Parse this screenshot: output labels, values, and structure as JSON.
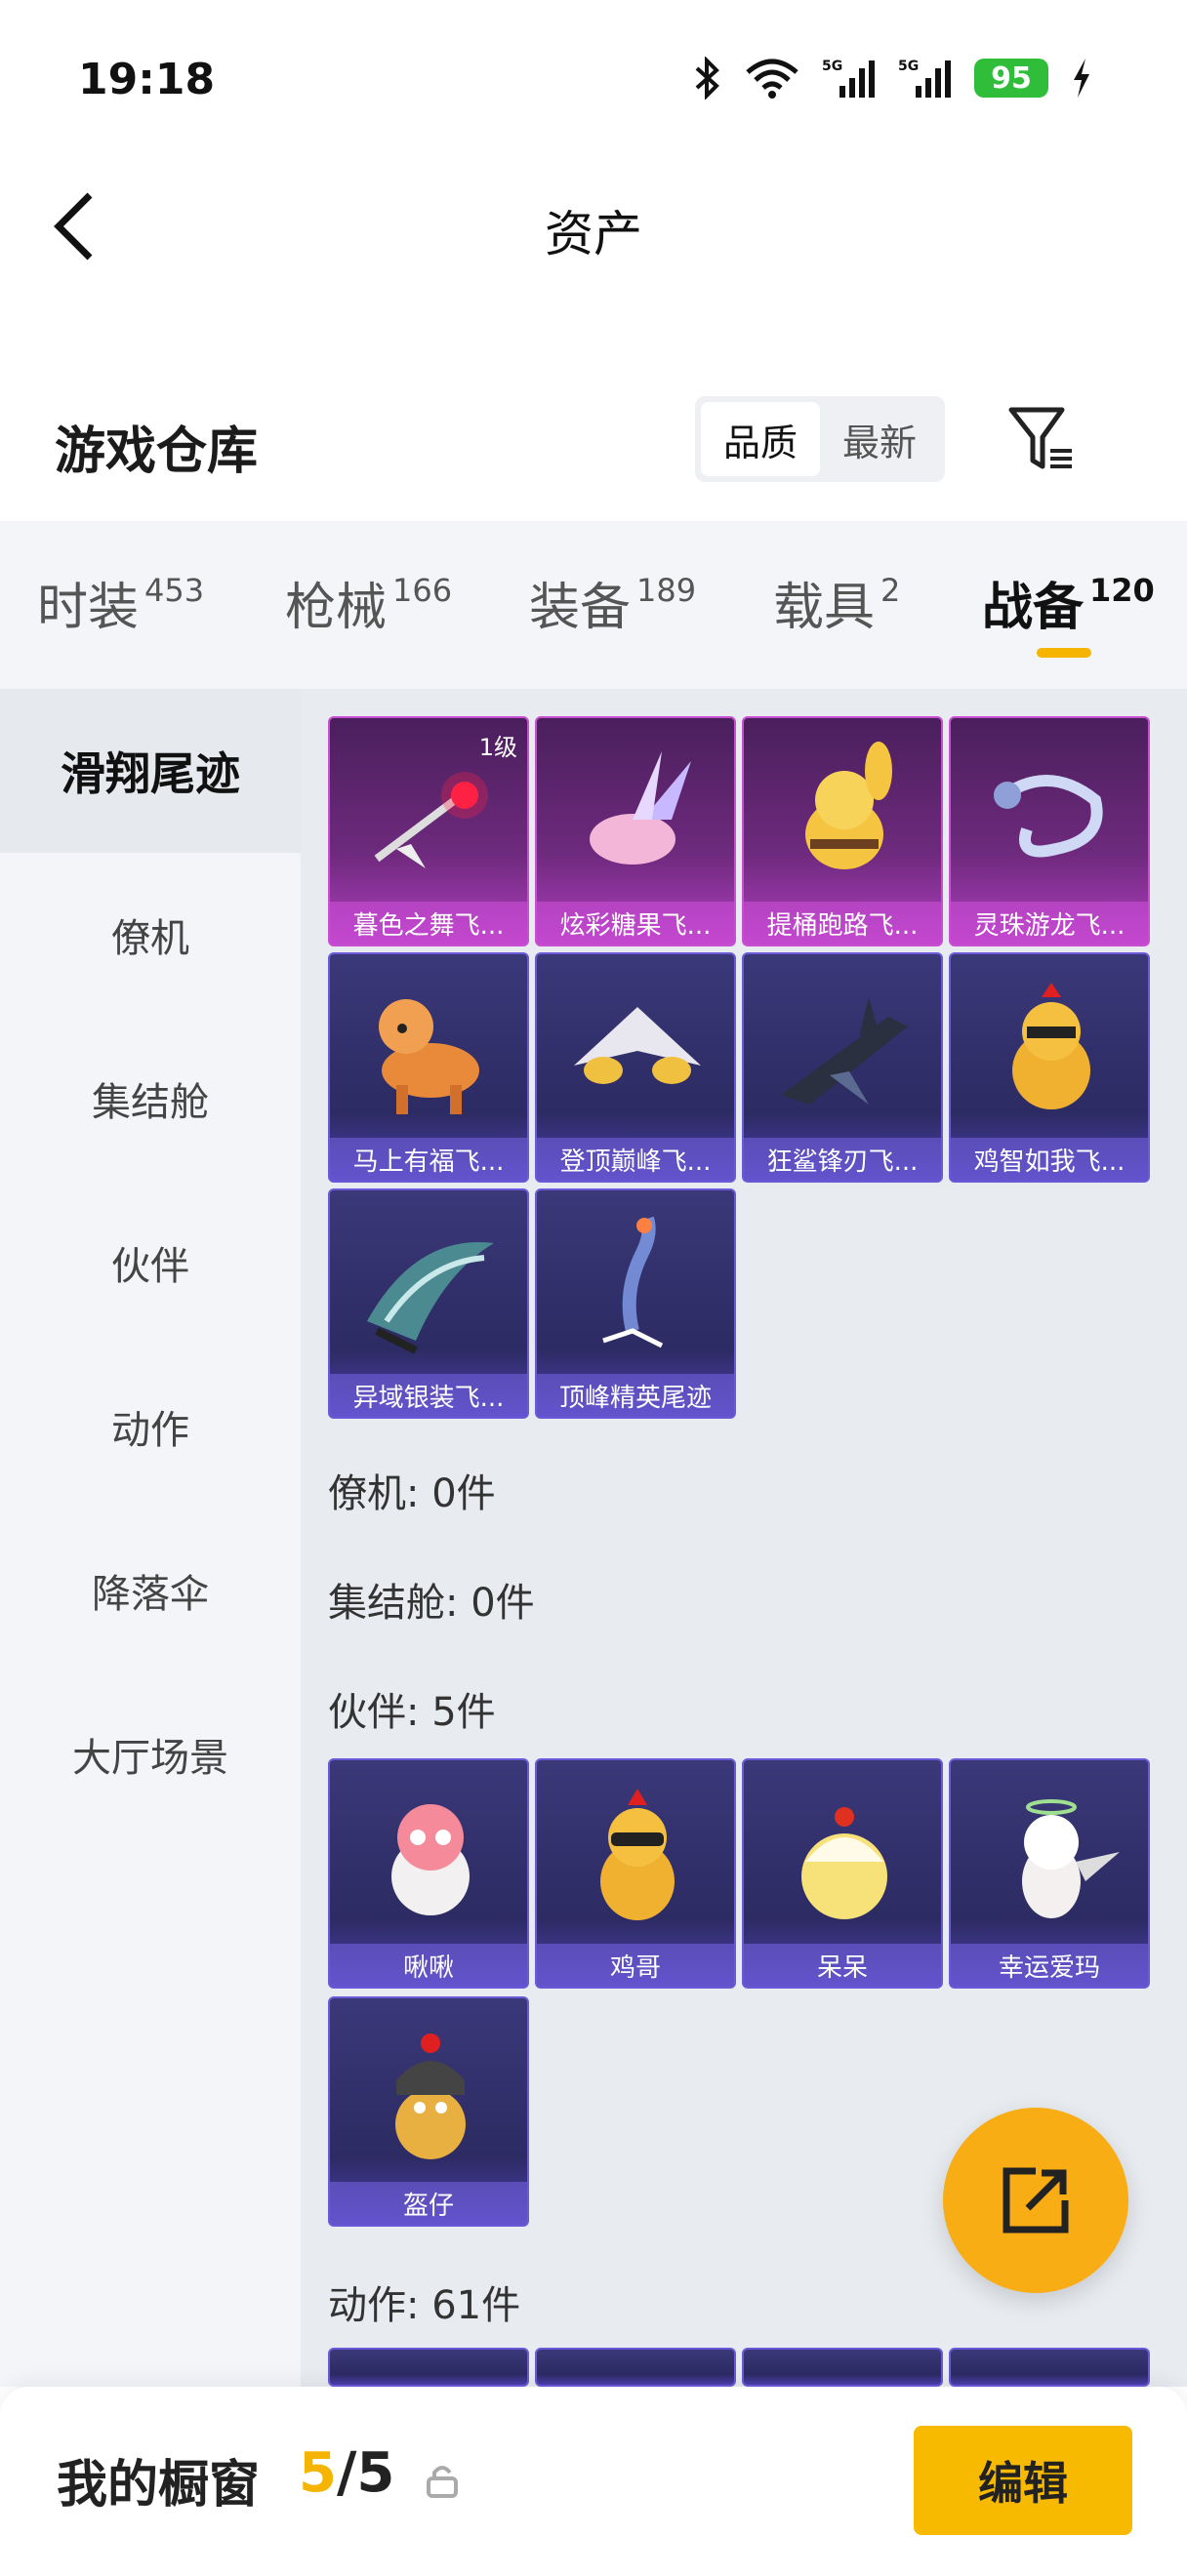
{
  "status": {
    "time": "19:18",
    "battery": "95",
    "net1": "5G",
    "net2": "5G"
  },
  "nav": {
    "title": "资产"
  },
  "header": {
    "section_title": "游戏仓库",
    "sort_options": [
      "品质",
      "最新"
    ]
  },
  "category_tabs": [
    {
      "label": "时装",
      "count": "453"
    },
    {
      "label": "枪械",
      "count": "166"
    },
    {
      "label": "装备",
      "count": "189"
    },
    {
      "label": "载具",
      "count": "2"
    },
    {
      "label": "战备",
      "count": "120"
    }
  ],
  "sidebar": {
    "items": [
      "滑翔尾迹",
      "僚机",
      "集结舱",
      "伙伴",
      "动作",
      "降落伞",
      "大厅场景"
    ]
  },
  "trail_items": [
    {
      "label": "暮色之舞飞...",
      "level": "1级",
      "icon": "comet-icon"
    },
    {
      "label": "炫彩糖果飞...",
      "icon": "candy-wing-icon"
    },
    {
      "label": "提桶跑路飞...",
      "icon": "bee-icon"
    },
    {
      "label": "灵珠游龙飞...",
      "icon": "dragon-icon"
    },
    {
      "label": "马上有福飞...",
      "icon": "horse-icon"
    },
    {
      "label": "登顶巅峰飞...",
      "icon": "jet-icon"
    },
    {
      "label": "狂鲨锋刃飞...",
      "icon": "shark-icon"
    },
    {
      "label": "鸡智如我飞...",
      "icon": "chicken-icon"
    },
    {
      "label": "异域银装飞...",
      "icon": "silver-wing-icon"
    },
    {
      "label": "顶峰精英尾迹",
      "icon": "smoke-trail-icon"
    }
  ],
  "groups": {
    "wingman": "僚机: 0件",
    "capsule": "集结舱: 0件",
    "partner": "伙伴: 5件",
    "action": "动作: 61件"
  },
  "partner_items": [
    {
      "label": "啾啾",
      "icon": "pink-bird-icon"
    },
    {
      "label": "鸡哥",
      "icon": "chicken-sunglasses-icon"
    },
    {
      "label": "呆呆",
      "icon": "chick-icon"
    },
    {
      "label": "幸运爱玛",
      "icon": "angel-cat-icon"
    },
    {
      "label": "盔仔",
      "icon": "helmet-chick-icon"
    }
  ],
  "bottom": {
    "window_label": "我的橱窗",
    "current": "5",
    "total": "5",
    "edit": "编辑"
  },
  "colors": {
    "accent": "#f4b400",
    "card_purple": "#c94fd2",
    "card_blue": "#6a5ad8"
  }
}
